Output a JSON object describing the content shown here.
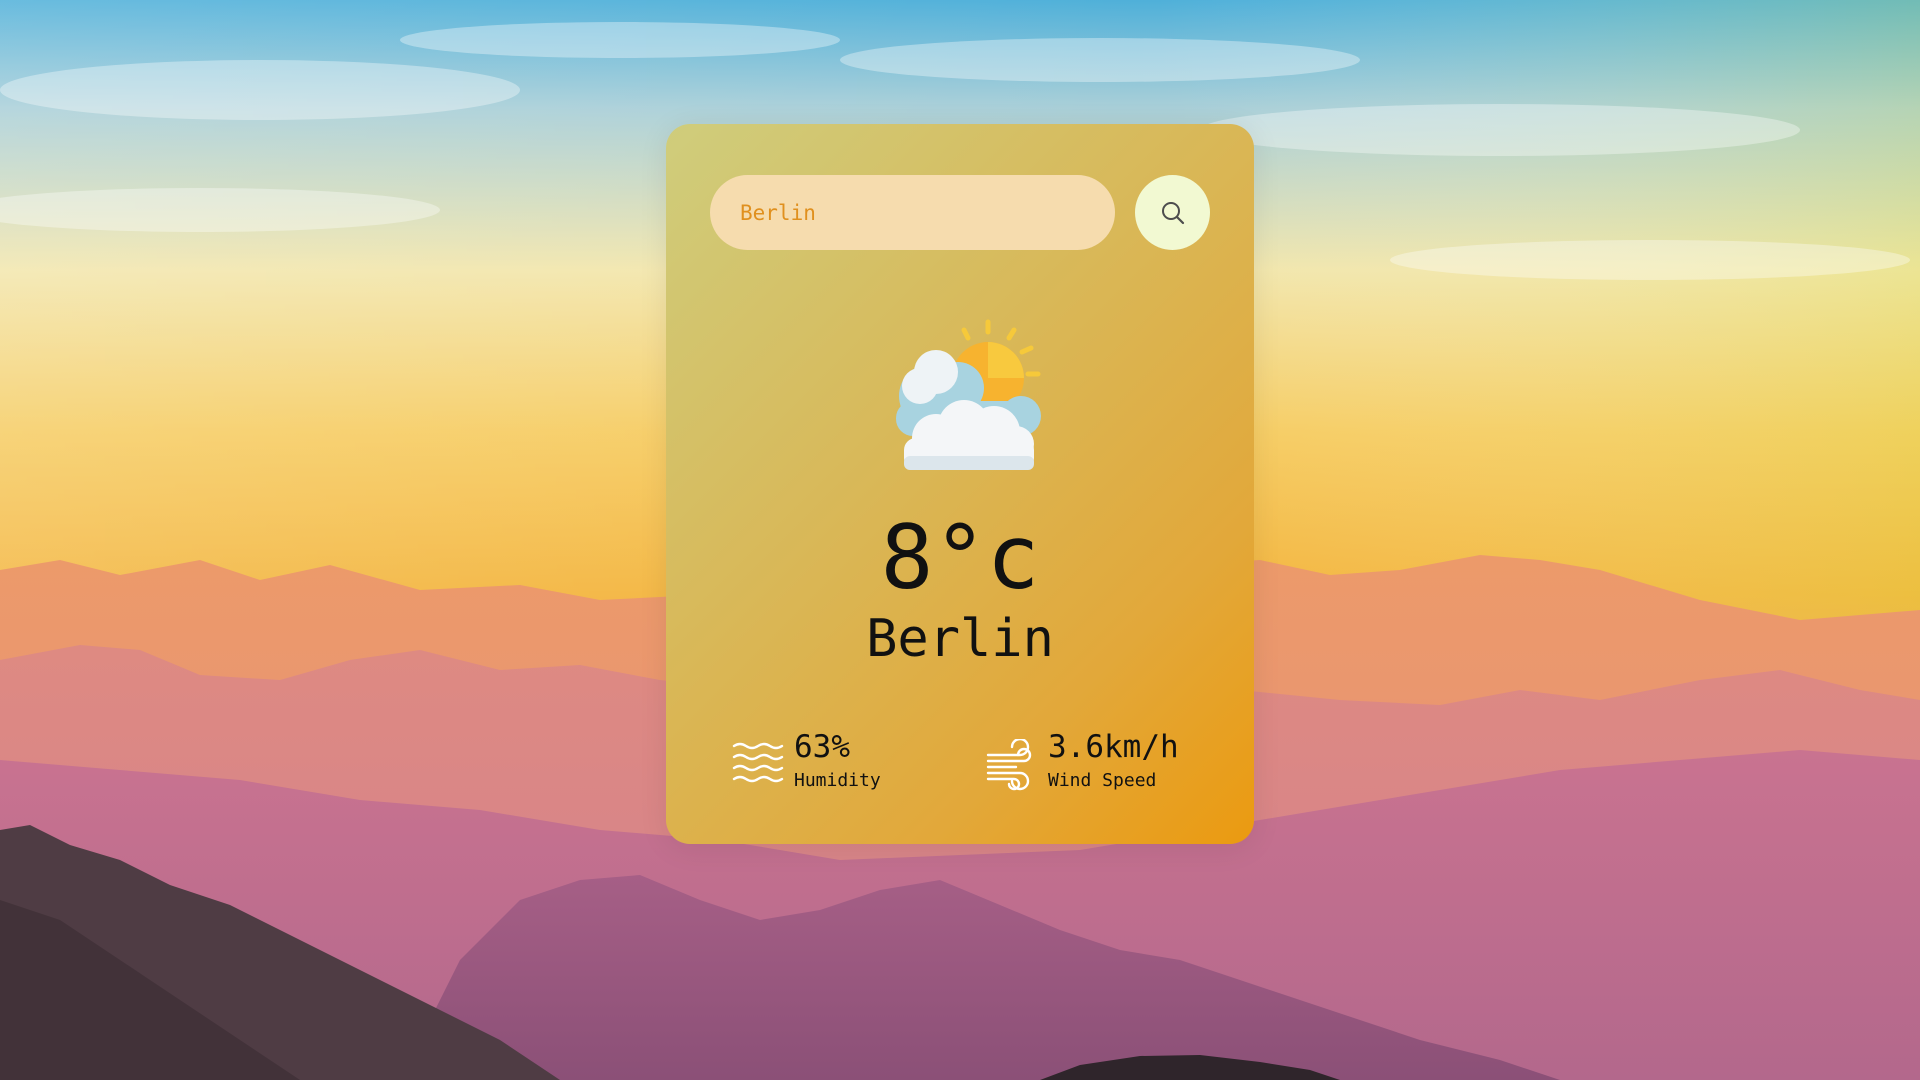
{
  "search": {
    "value": "Berlin",
    "placeholder": ""
  },
  "weather": {
    "icon": "partly-cloudy-sun-icon",
    "temperature": "8°c",
    "city": "Berlin"
  },
  "stats": {
    "humidity": {
      "value": "63%",
      "label": "Humidity",
      "icon": "humidity-waves-icon"
    },
    "wind": {
      "value": "3.6km/h",
      "label": "Wind Speed",
      "icon": "wind-icon"
    }
  },
  "colors": {
    "card_top_left": "#cfcd7c",
    "card_bottom_right": "#eb9a10",
    "search_field": "#f6dcae",
    "search_text": "#e0901e",
    "search_button": "#f2f9d2"
  }
}
